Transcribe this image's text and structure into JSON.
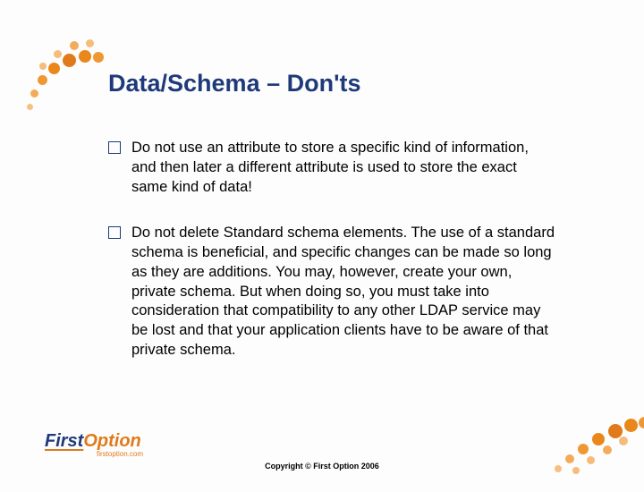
{
  "title": "Data/Schema – Don'ts",
  "bullets": [
    "Do not use an attribute to store a specific kind of information, and then later a different attribute is used to store the exact same kind of data!",
    "Do not delete Standard schema elements. The use of a standard schema is beneficial, and specific changes can be made so long as they are additions. You may, however, create your own, private schema. But when doing so, you must take into consideration that compatibility to any other LDAP service may be lost and that your application clients have to be aware of that private schema."
  ],
  "logo": {
    "first": "First",
    "second": "Option",
    "sub": "firstoption.com"
  },
  "copyright": "Copyright © First Option 2006"
}
